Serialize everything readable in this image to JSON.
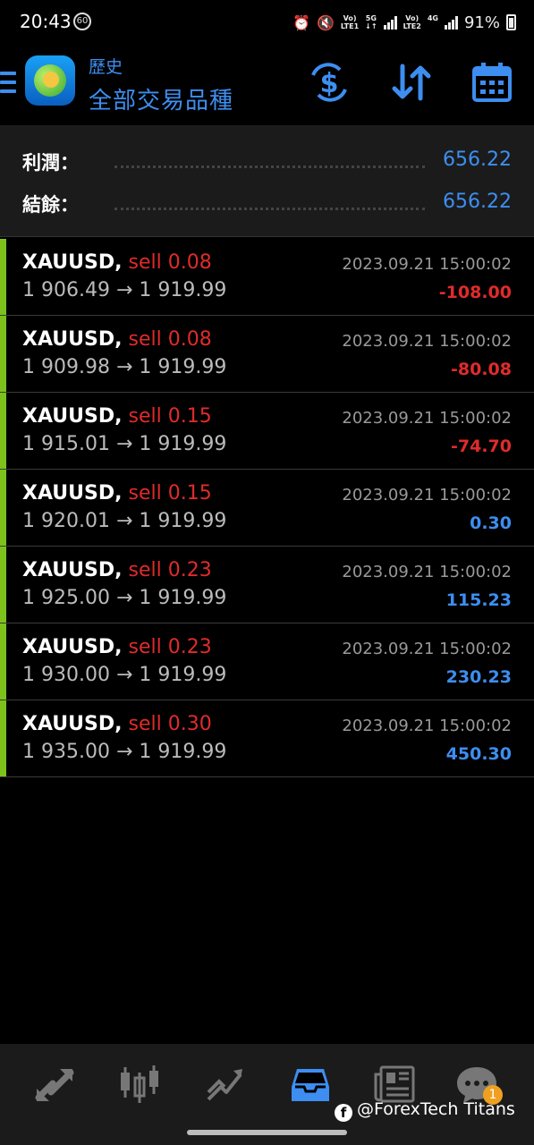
{
  "status_bar": {
    "time": "20:43",
    "badge": "60",
    "net1": "Vo) LTE1",
    "net1_top": "Vo)",
    "net1_bottom": "LTE1",
    "g1": "5G",
    "net2_top": "Vo)",
    "net2_bottom": "LTE2",
    "g2": "4G",
    "battery": "91%"
  },
  "header": {
    "subtitle": "歷史",
    "title": "全部交易品種",
    "accent_color": "#3d8ef0"
  },
  "summary": {
    "profit_label": "利潤：",
    "profit_value": "656.22",
    "balance_label": "結餘：",
    "balance_value": "656.22"
  },
  "deals": [
    {
      "symbol": "XAUUSD,",
      "side": "sell 0.08",
      "prices": "1 906.49 → 1 919.99",
      "time": "2023.09.21 15:00:02",
      "profit": "-108.00"
    },
    {
      "symbol": "XAUUSD,",
      "side": "sell 0.08",
      "prices": "1 909.98 → 1 919.99",
      "time": "2023.09.21 15:00:02",
      "profit": "-80.08"
    },
    {
      "symbol": "XAUUSD,",
      "side": "sell 0.15",
      "prices": "1 915.01 → 1 919.99",
      "time": "2023.09.21 15:00:02",
      "profit": "-74.70"
    },
    {
      "symbol": "XAUUSD,",
      "side": "sell 0.15",
      "prices": "1 920.01 → 1 919.99",
      "time": "2023.09.21 15:00:02",
      "profit": "0.30"
    },
    {
      "symbol": "XAUUSD,",
      "side": "sell 0.23",
      "prices": "1 925.00 → 1 919.99",
      "time": "2023.09.21 15:00:02",
      "profit": "115.23"
    },
    {
      "symbol": "XAUUSD,",
      "side": "sell 0.23",
      "prices": "1 930.00 → 1 919.99",
      "time": "2023.09.21 15:00:02",
      "profit": "230.23"
    },
    {
      "symbol": "XAUUSD,",
      "side": "sell 0.30",
      "prices": "1 935.00 → 1 919.99",
      "time": "2023.09.21 15:00:02",
      "profit": "450.30"
    }
  ],
  "bottom_nav": {
    "items": [
      "quotes-icon",
      "chart-icon",
      "trade-icon",
      "history-icon",
      "news-icon",
      "chat-icon"
    ],
    "active": "history-icon",
    "chat_badge": "1",
    "watermark": "@ForexTech Titans"
  },
  "colors": {
    "negative": "#e02b2b",
    "positive": "#3d8ef0",
    "sell": "#e02b2b",
    "row_bar": "#7cc21a"
  }
}
